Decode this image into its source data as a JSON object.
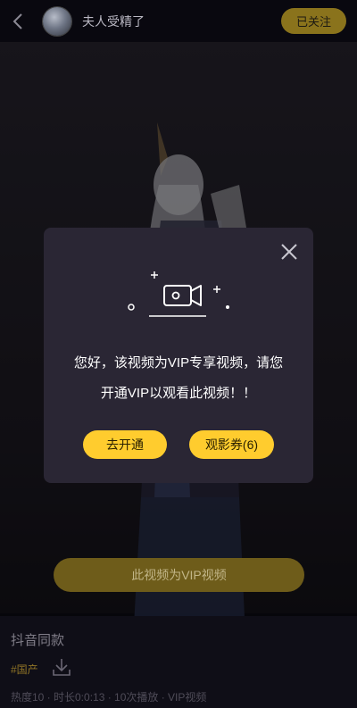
{
  "header": {
    "username": "夫人受精了",
    "follow_label": "已关注"
  },
  "modal": {
    "line1": "您好，该视频为VIP专享视频，请您",
    "line2": "开通VIP以观看此视频！！",
    "open_label": "去开通",
    "ticket_label": "观影券(6)"
  },
  "vip_banner": "此视频为VIP视频",
  "info": {
    "title": "抖音同款",
    "tag": "#国产",
    "meta": "热度10 · 时长0:0:13 · 10次播放 · VIP视频"
  },
  "colors": {
    "accent": "#ffcc2e",
    "modal_bg": "#2a2634",
    "follow_bg": "#8a731c"
  },
  "icons": [
    "back-arrow-icon",
    "close-icon",
    "video-camera-icon",
    "download-icon"
  ]
}
